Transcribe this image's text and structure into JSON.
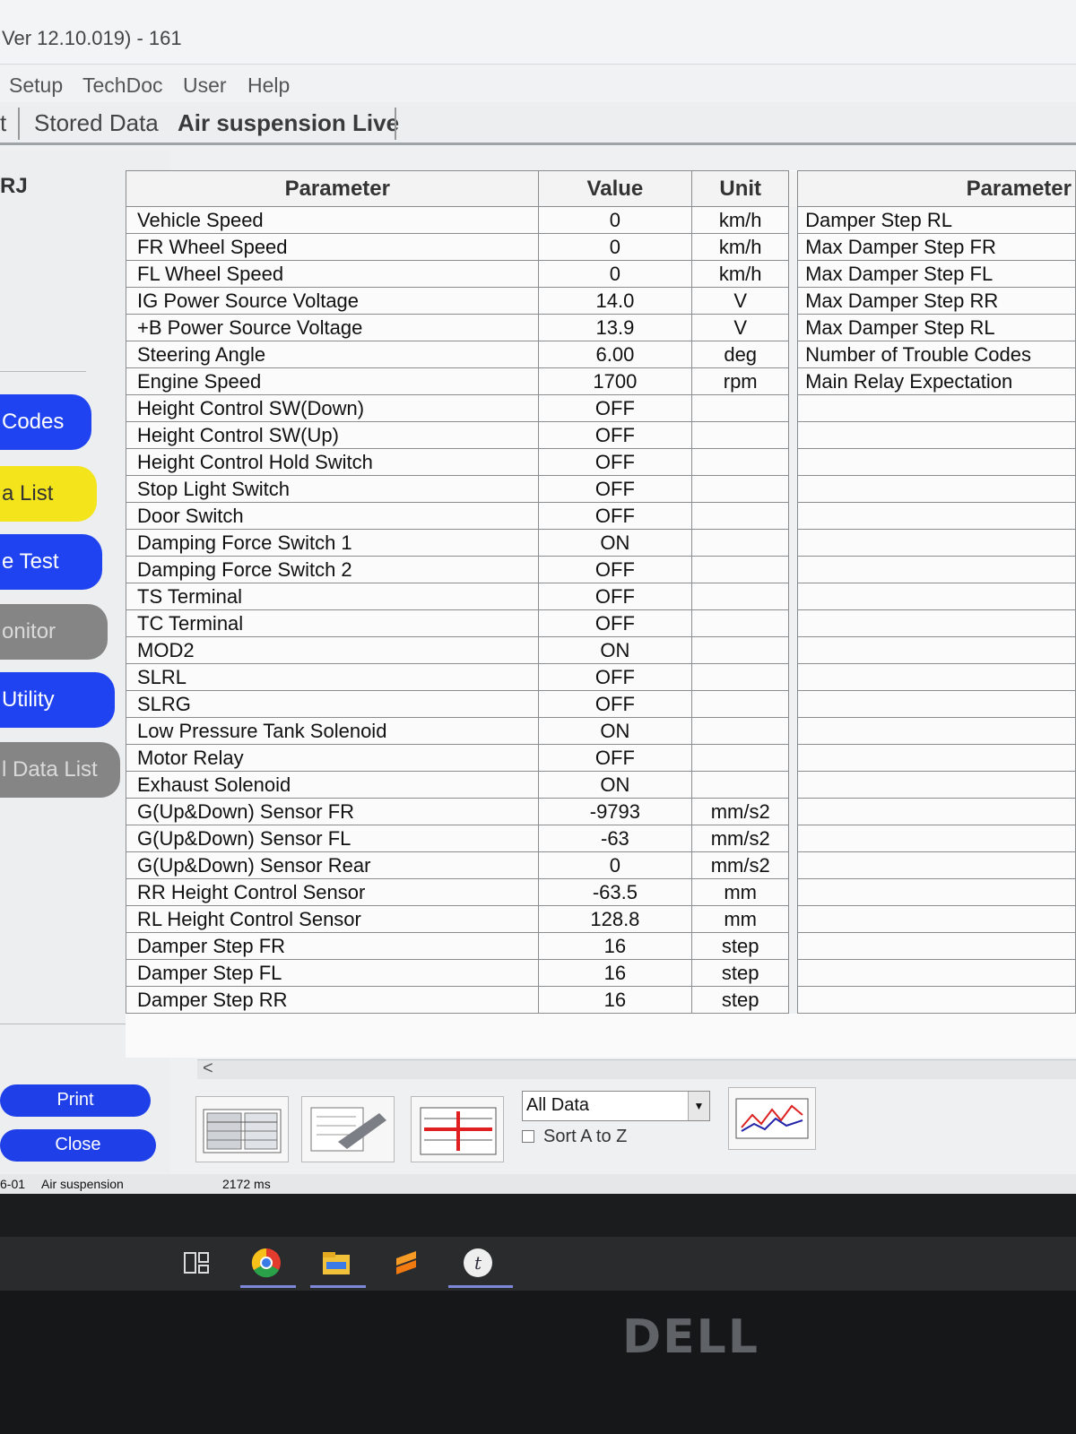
{
  "window": {
    "title": "Ver 12.10.019) - 161"
  },
  "menu": [
    "Setup",
    "TechDoc",
    "User",
    "Help"
  ],
  "tabs": {
    "left_fragment": "t",
    "stored": "Stored Data",
    "active": "Air suspension Live"
  },
  "sidebar": {
    "ecu_label": "RJ",
    "buttons": [
      {
        "label": "Codes",
        "color": "#1f43f0"
      },
      {
        "label": "a List",
        "color": "#f4e41c"
      },
      {
        "label": "e Test",
        "color": "#1f43f0"
      },
      {
        "label": "onitor",
        "color": "#858585"
      },
      {
        "label": "Utility",
        "color": "#1f43f0"
      },
      {
        "label": "l Data List",
        "color": "#858585"
      }
    ],
    "print": "Print",
    "close": "Close"
  },
  "grid": {
    "headers": {
      "parameter": "Parameter",
      "value": "Value",
      "unit": "Unit",
      "parameter2": "Parameter"
    },
    "rows": [
      {
        "p": "Vehicle Speed",
        "v": "0",
        "u": "km/h",
        "p2": "Damper Step RL"
      },
      {
        "p": "FR Wheel Speed",
        "v": "0",
        "u": "km/h",
        "p2": "Max Damper Step FR"
      },
      {
        "p": "FL Wheel Speed",
        "v": "0",
        "u": "km/h",
        "p2": "Max Damper Step FL"
      },
      {
        "p": "IG Power Source Voltage",
        "v": "14.0",
        "u": "V",
        "p2": "Max Damper Step RR"
      },
      {
        "p": "+B Power Source Voltage",
        "v": "13.9",
        "u": "V",
        "p2": "Max Damper Step RL"
      },
      {
        "p": "Steering Angle",
        "v": "6.00",
        "u": "deg",
        "p2": "Number of Trouble Codes"
      },
      {
        "p": "Engine Speed",
        "v": "1700",
        "u": "rpm",
        "p2": "Main Relay Expectation"
      },
      {
        "p": "Height Control SW(Down)",
        "v": "OFF",
        "u": "",
        "p2": ""
      },
      {
        "p": "Height Control SW(Up)",
        "v": "OFF",
        "u": "",
        "p2": ""
      },
      {
        "p": "Height Control Hold Switch",
        "v": "OFF",
        "u": "",
        "p2": ""
      },
      {
        "p": "Stop Light Switch",
        "v": "OFF",
        "u": "",
        "p2": ""
      },
      {
        "p": "Door Switch",
        "v": "OFF",
        "u": "",
        "p2": ""
      },
      {
        "p": "Damping Force Switch 1",
        "v": "ON",
        "u": "",
        "p2": ""
      },
      {
        "p": "Damping Force Switch 2",
        "v": "OFF",
        "u": "",
        "p2": ""
      },
      {
        "p": "TS Terminal",
        "v": "OFF",
        "u": "",
        "p2": ""
      },
      {
        "p": "TC Terminal",
        "v": "OFF",
        "u": "",
        "p2": ""
      },
      {
        "p": "MOD2",
        "v": "ON",
        "u": "",
        "p2": ""
      },
      {
        "p": "SLRL",
        "v": "OFF",
        "u": "",
        "p2": ""
      },
      {
        "p": "SLRG",
        "v": "OFF",
        "u": "",
        "p2": ""
      },
      {
        "p": "Low Pressure Tank Solenoid",
        "v": "ON",
        "u": "",
        "p2": ""
      },
      {
        "p": "Motor Relay",
        "v": "OFF",
        "u": "",
        "p2": ""
      },
      {
        "p": "Exhaust Solenoid",
        "v": "ON",
        "u": "",
        "p2": ""
      },
      {
        "p": "G(Up&Down) Sensor FR",
        "v": "-9793",
        "u": "mm/s2",
        "p2": ""
      },
      {
        "p": "G(Up&Down) Sensor FL",
        "v": "-63",
        "u": "mm/s2",
        "p2": ""
      },
      {
        "p": "G(Up&Down) Sensor Rear",
        "v": "0",
        "u": "mm/s2",
        "p2": ""
      },
      {
        "p": "RR Height Control Sensor",
        "v": "-63.5",
        "u": "mm",
        "p2": ""
      },
      {
        "p": "RL Height Control Sensor",
        "v": "128.8",
        "u": "mm",
        "p2": ""
      },
      {
        "p": "Damper Step FR",
        "v": "16",
        "u": "step",
        "p2": ""
      },
      {
        "p": "Damper Step FL",
        "v": "16",
        "u": "step",
        "p2": ""
      },
      {
        "p": "Damper Step RR",
        "v": "16",
        "u": "step",
        "p2": ""
      }
    ]
  },
  "scroll": {
    "left_arrow": "<"
  },
  "toolbar": {
    "filter_selected": "All Data",
    "sort_label": "Sort A to Z",
    "icons": [
      "parameter-columns-icon",
      "record-icon",
      "data-select-icon",
      "graph-icon"
    ]
  },
  "status": {
    "ecu_code": "6-01",
    "system": "Air suspension",
    "interval": "2172 ms"
  },
  "taskbar": {
    "icons": [
      "task-view-icon",
      "chrome-icon",
      "file-explorer-icon",
      "sublime-icon",
      "techstream-icon"
    ]
  },
  "bezel": {
    "brand": "DELL"
  },
  "colors": {
    "blue_button": "#1f43f0",
    "yellow_button": "#f4e41c",
    "gray_button": "#858585"
  }
}
